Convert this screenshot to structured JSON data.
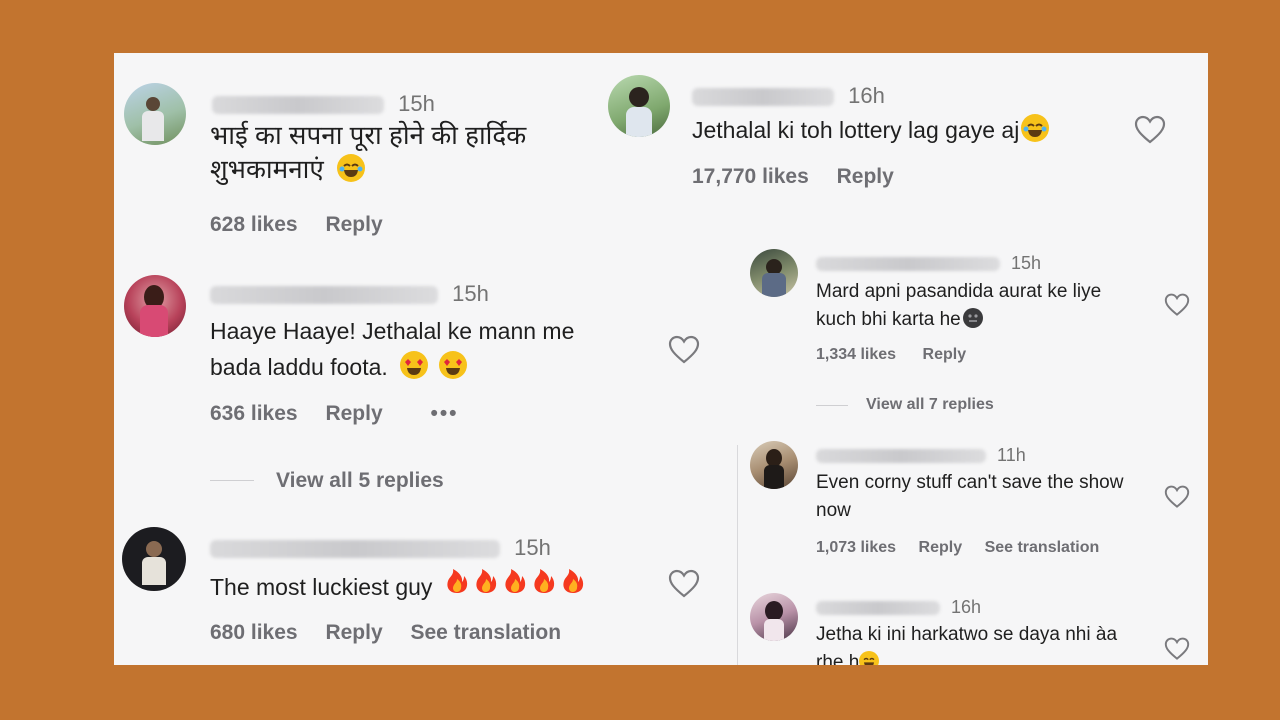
{
  "left_comments": [
    {
      "time": "15h",
      "text_line1": "भाई का सपना पूरा होने की हार्दिक",
      "text_line2": "शुभकामनाएं",
      "likes": "628 likes",
      "reply": "Reply"
    },
    {
      "time": "15h",
      "text_line1": "Haaye Haaye! Jethalal ke mann me",
      "text_line2": "bada laddu foota.",
      "likes": "636 likes",
      "reply": "Reply",
      "more": "•••",
      "view_replies": "View all 5 replies"
    },
    {
      "time": "15h",
      "text_line1": "The most luckiest guy",
      "likes": "680 likes",
      "reply": "Reply",
      "see_translation": "See translation"
    }
  ],
  "right_top_comment": {
    "time": "16h",
    "text_line1": "Jethalal ki toh lottery lag gaye aj",
    "likes": "17,770 likes",
    "reply": "Reply"
  },
  "right_comments": [
    {
      "time": "15h",
      "text_line1": "Mard apni pasandida aurat ke liye",
      "text_line2": "kuch bhi karta he",
      "likes": "1,334 likes",
      "reply": "Reply",
      "view_replies": "View all 7 replies"
    },
    {
      "time": "11h",
      "text_line1": "Even corny stuff can't save the show",
      "text_line2": "now",
      "likes": "1,073 likes",
      "reply": "Reply",
      "see_translation": "See translation"
    },
    {
      "time": "16h",
      "text_line1": "Jetha ki ini harkatwo se daya nhi àa",
      "text_line2": "rhe h"
    }
  ],
  "icons": {
    "heart": "heart-outline-icon",
    "laugh": "laughing-emoji-icon",
    "heart_eyes": "heart-eyes-emoji-icon",
    "fire": "fire-emoji-icon",
    "dark": "dark-face-emoji-icon"
  },
  "colors": {
    "background": "#c2742f",
    "card": "#f6f6f7",
    "meta_text": "#6e6e73"
  }
}
